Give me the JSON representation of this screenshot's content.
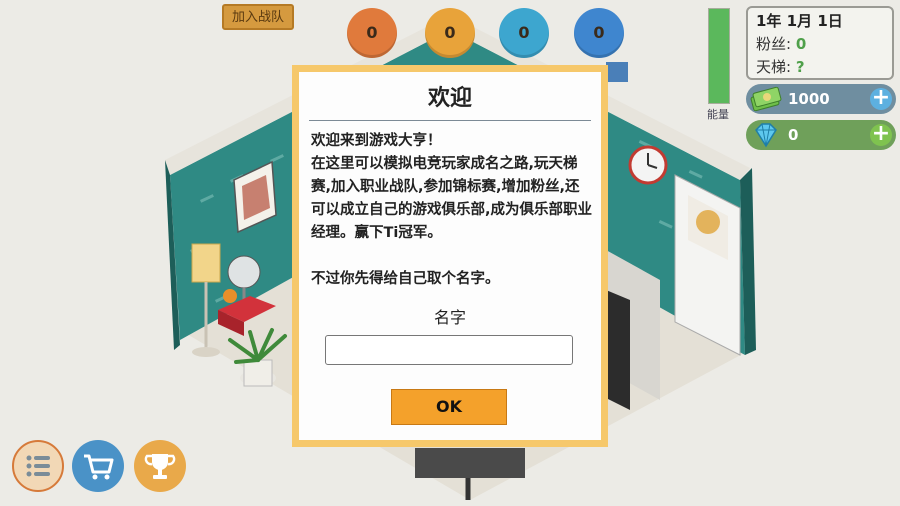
{
  "header": {
    "join_team_label": "加入战队",
    "stats": [
      {
        "value": "0",
        "color": "#e07a3c"
      },
      {
        "value": "0",
        "color": "#e8a33a"
      },
      {
        "value": "0",
        "color": "#3da6cf"
      },
      {
        "value": "0",
        "color": "#3f86cf"
      }
    ],
    "energy_label": "能量",
    "energy_level": 1.0
  },
  "info": {
    "date": "1年 1月 1日",
    "fans_label": "粉丝:",
    "fans_value": "0",
    "ladder_label": "天梯:",
    "ladder_value": "?"
  },
  "currency": {
    "cash": {
      "value": "1000",
      "icon": "cash-stack-icon"
    },
    "gems": {
      "value": "0",
      "icon": "diamond-icon"
    }
  },
  "bottom_buttons": [
    {
      "icon": "list-icon",
      "color": "#f2d8b6"
    },
    {
      "icon": "cart-icon",
      "color": "#4a92c7"
    },
    {
      "icon": "trophy-icon",
      "color": "#e9a94a"
    }
  ],
  "dialog": {
    "title": "欢迎",
    "body": "欢迎来到游戏大亨！\n在这里可以模拟电竞玩家成名之路,玩天梯赛,加入职业战队,参加锦标赛,增加粉丝,还可以成立自己的游戏俱乐部,成为俱乐部职业经理。赢下Ti冠军。\n\n不过你先得给自己取个名字。",
    "name_label": "名字",
    "name_value": "",
    "ok_label": "OK"
  },
  "colors": {
    "accent": "#f4a12b",
    "dialog_border": "#f6c86b",
    "wall": "#2f7f7a"
  }
}
